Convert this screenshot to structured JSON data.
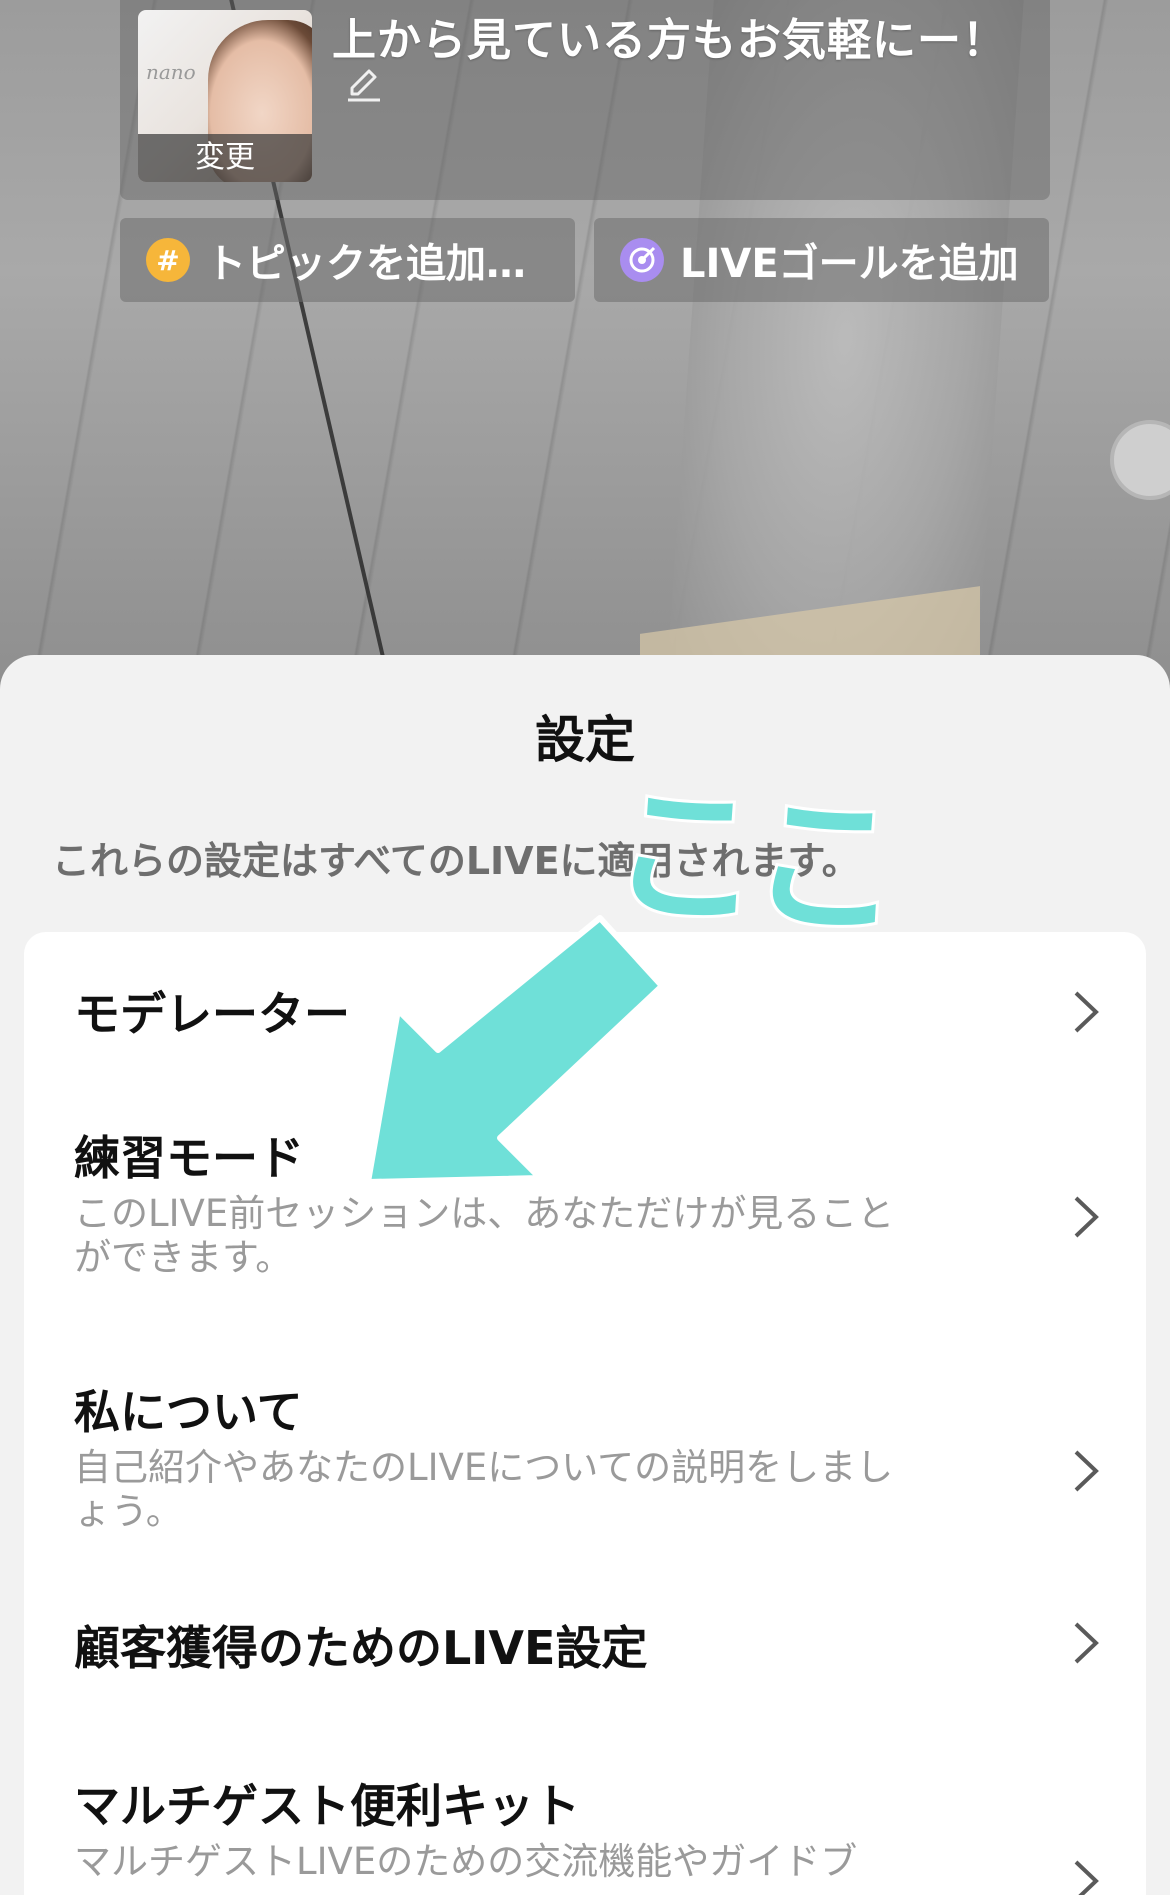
{
  "header": {
    "thumbnail_change_label": "変更",
    "live_title": "上から見ている方もお気軽にー！",
    "thumbnail_signature": "nano",
    "chips": {
      "topic_label": "トピックを追加…",
      "goal_label": "LIVEゴールを追加"
    }
  },
  "sheet": {
    "title": "設定",
    "description": "これらの設定はすべてのLIVEに適用されます。",
    "items": [
      {
        "title": "モデレーター",
        "subtitle": ""
      },
      {
        "title": "練習モード",
        "subtitle": "このLIVE前セッションは、あなただけが見ることができます。"
      },
      {
        "title": "私について",
        "subtitle": "自己紹介やあなたのLIVEについての説明をしましょう。"
      },
      {
        "title": "顧客獲得のためのLIVE設定",
        "subtitle": ""
      },
      {
        "title": "マルチゲスト便利キット",
        "subtitle": "マルチゲストLIVEのための交流機能やガイドブ"
      }
    ]
  },
  "annotation": {
    "text": "ここ",
    "color": "#6fe0d8"
  },
  "colors": {
    "sheet_bg": "#f2f2f2",
    "card_bg": "#ffffff",
    "topic_icon": "#f6b63a",
    "goal_icon": "#a98df0",
    "subtitle_text": "#9a9a9a"
  },
  "icons": {
    "topic": "hashtag-icon",
    "goal": "target-icon",
    "edit": "pencil-icon",
    "row": "chevron-right-icon"
  }
}
